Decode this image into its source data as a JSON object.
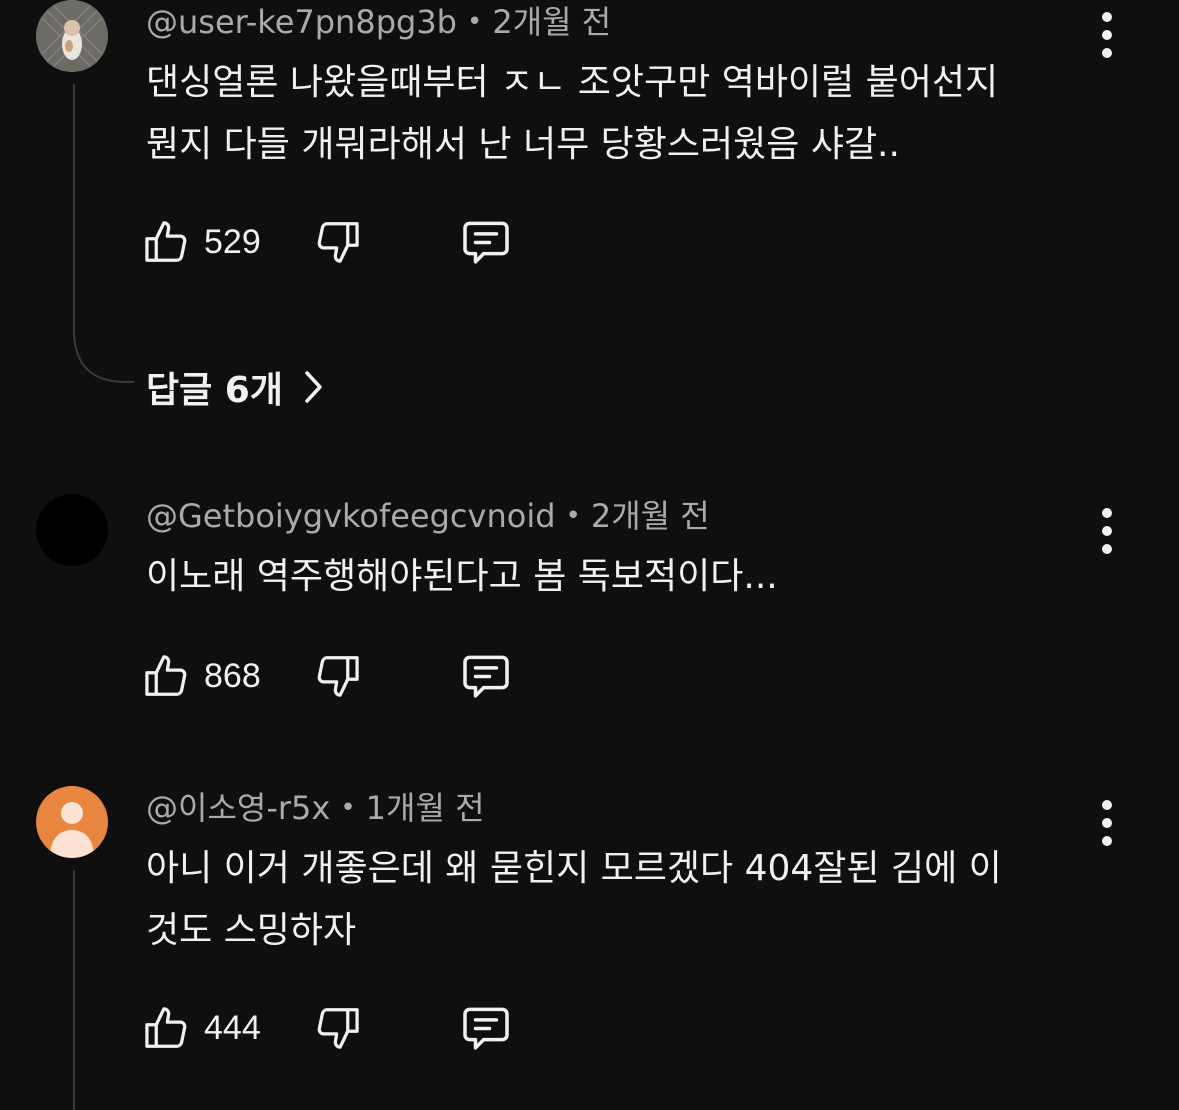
{
  "comments": [
    {
      "author": "@user-ke7pn8pg3b",
      "time": "2개월 전",
      "lines": [
        "댄싱얼론 나왔을때부터 ㅈㄴ 조앗구만 역바이럴 붙어선지",
        "뭔지 다들 개뭐라해서 난 너무 당황스러웠음 샤갈.."
      ],
      "likes": "529",
      "replies_label": "답글 6개"
    },
    {
      "author": "@Getboiygvkofeegcvnoid",
      "time": "2개월 전",
      "lines": [
        "이노래 역주행해야된다고 봄 독보적이다..."
      ],
      "likes": "868"
    },
    {
      "author": "@이소영-r5x",
      "time": "1개월 전",
      "lines": [
        "아니 이거 개좋은데 왜 묻힌지 모르겠다 404잘된 김에 이",
        "것도 스밍하자"
      ],
      "likes": "444"
    }
  ],
  "separator": "•",
  "icons": {
    "like": "thumbs-up-icon",
    "dislike": "thumbs-down-icon",
    "reply": "comment-icon",
    "more": "more-vert-icon",
    "chevron": "chevron-right-icon"
  },
  "colors": {
    "background": "#0f0f0f",
    "text": "#f1f1f1",
    "meta": "#aaaaaa",
    "thread_line": "#3a3a3a",
    "avatar_orange": "#e8863f"
  }
}
